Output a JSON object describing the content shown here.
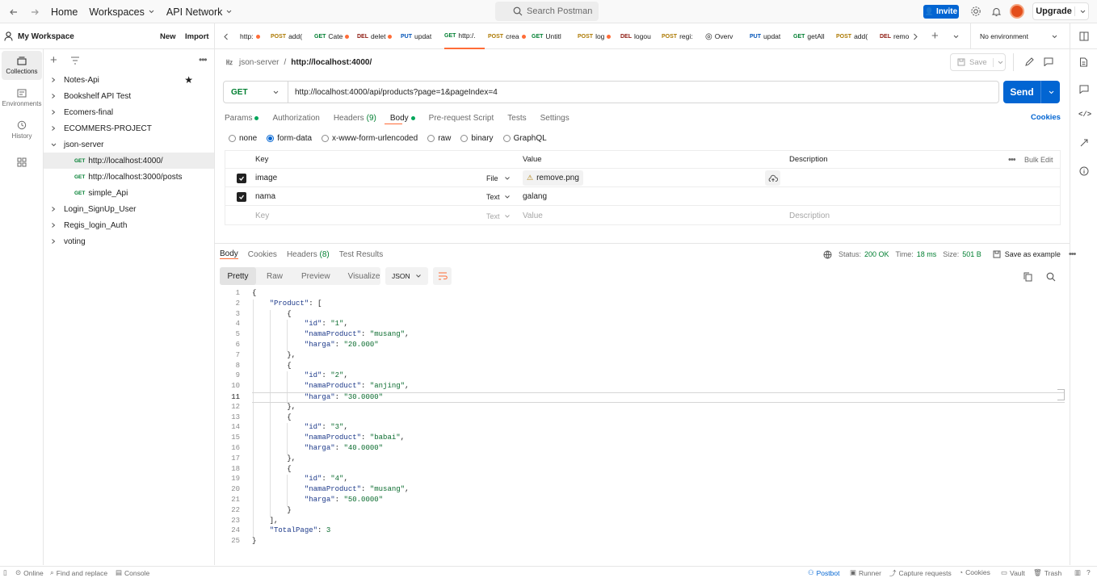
{
  "topbar": {
    "home": "Home",
    "workspaces": "Workspaces",
    "api_network": "API Network",
    "search": "Search Postman",
    "invite": "Invite",
    "upgrade": "Upgrade"
  },
  "sidebar": {
    "workspace": "My Workspace",
    "new": "New",
    "import": "Import",
    "rail": [
      {
        "label": "Collections",
        "icon": "collections-icon"
      },
      {
        "label": "Environments",
        "icon": "environments-icon"
      },
      {
        "label": "History",
        "icon": "history-icon"
      }
    ],
    "items": [
      {
        "label": "Notes-Api",
        "starred": true
      },
      {
        "label": "Bookshelf API Test"
      },
      {
        "label": "Ecomers-final"
      },
      {
        "label": "ECOMMERS-PROJECT"
      },
      {
        "label": "json-server",
        "expanded": true
      },
      {
        "method": "GET",
        "label": "http://localhost:4000/",
        "selected": true
      },
      {
        "method": "GET",
        "label": "http://localhost:3000/posts"
      },
      {
        "method": "GET",
        "label": "simple_Api"
      },
      {
        "label": "Login_SignUp_User"
      },
      {
        "label": "Regis_login_Auth"
      },
      {
        "label": "voting"
      }
    ]
  },
  "tabs": [
    {
      "method": "",
      "label": "http:",
      "dot": true
    },
    {
      "method": "POST",
      "label": "add(",
      "dot": false
    },
    {
      "method": "GET",
      "label": "Cate",
      "dot": true
    },
    {
      "method": "DEL",
      "label": "delet",
      "dot": true
    },
    {
      "method": "PUT",
      "label": "updat",
      "dot": false
    },
    {
      "method": "GET",
      "label": "http:/.",
      "dot": false,
      "active": true
    },
    {
      "method": "POST",
      "label": "crea",
      "dot": true
    },
    {
      "method": "GET",
      "label": "Untitl",
      "dot": false
    },
    {
      "method": "POST",
      "label": "log",
      "dot": true
    },
    {
      "method": "DEL",
      "label": "logou",
      "dot": false
    },
    {
      "method": "POST",
      "label": "regi:",
      "dot": false
    },
    {
      "method": "",
      "label": "Overv",
      "dot": false
    },
    {
      "method": "PUT",
      "label": "updat",
      "dot": false
    },
    {
      "method": "GET",
      "label": "getAll",
      "dot": false
    },
    {
      "method": "POST",
      "label": "add(",
      "dot": false
    },
    {
      "method": "DEL",
      "label": "remo",
      "dot": false
    }
  ],
  "environment": "No environment",
  "request": {
    "breadcrumb_parent": "json-server",
    "breadcrumb_current": "http://localhost:4000/",
    "save": "Save",
    "method": "GET",
    "url": "http://localhost:4000/api/products?page=1&pageIndex=4",
    "send": "Send",
    "subtabs": [
      "Params",
      "Authorization",
      "Headers",
      "Body",
      "Pre-request Script",
      "Tests",
      "Settings"
    ],
    "headers_count": "(9)",
    "cookies": "Cookies",
    "body_types": [
      "none",
      "form-data",
      "x-www-form-urlencoded",
      "raw",
      "binary",
      "GraphQL"
    ],
    "body_selected": "form-data",
    "grid_headers": {
      "key": "Key",
      "value": "Value",
      "description": "Description",
      "bulk_edit": "Bulk Edit"
    },
    "form_rows": [
      {
        "key": "image",
        "type": "File",
        "value": "remove.png"
      },
      {
        "key": "nama",
        "type": "Text",
        "value": "galang"
      }
    ],
    "placeholder": {
      "key": "Key",
      "type": "Text",
      "value": "Value",
      "description": "Description"
    }
  },
  "response": {
    "tabs": [
      "Body",
      "Cookies",
      "Headers",
      "Test Results"
    ],
    "headers_count": "(8)",
    "status_label": "Status:",
    "status": "200 OK",
    "time_label": "Time:",
    "time": "18 ms",
    "size_label": "Size:",
    "size": "501 B",
    "save_example": "Save as example",
    "view_tabs": [
      "Pretty",
      "Raw",
      "Preview",
      "Visualize"
    ],
    "format": "JSON",
    "code": [
      "{",
      "    \"Product\": [",
      "        {",
      "            \"id\": \"1\",",
      "            \"namaProduct\": \"musang\",",
      "            \"harga\": \"20.000\"",
      "        },",
      "        {",
      "            \"id\": \"2\",",
      "            \"namaProduct\": \"anjing\",",
      "            \"harga\": \"30.0000\"",
      "        },",
      "        {",
      "            \"id\": \"3\",",
      "            \"namaProduct\": \"babai\",",
      "            \"harga\": \"40.0000\"",
      "        },",
      "        {",
      "            \"id\": \"4\",",
      "            \"namaProduct\": \"musang\",",
      "            \"harga\": \"50.0000\"",
      "        }",
      "    ],",
      "    \"TotalPage\": 3",
      "}"
    ],
    "active_line": 11
  },
  "statusbar": {
    "online": "Online",
    "find": "Find and replace",
    "console": "Console",
    "postbot": "Postbot",
    "runner": "Runner",
    "capture": "Capture requests",
    "cookies": "Cookies",
    "vault": "Vault",
    "trash": "Trash"
  },
  "colors": {
    "accent": "#ff6c37",
    "primary": "#0265d2",
    "get": "#007f31",
    "post": "#ad7a03",
    "del": "#8e1a10",
    "put": "#0053b8"
  }
}
